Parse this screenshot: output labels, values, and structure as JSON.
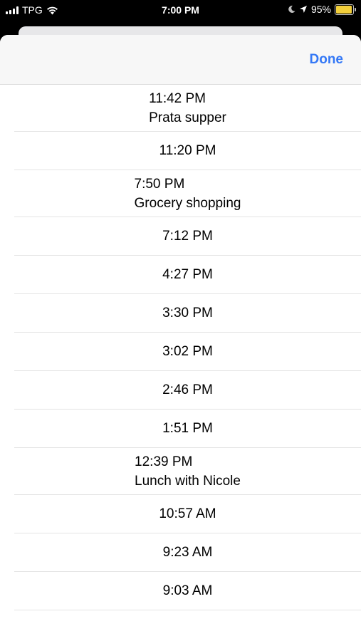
{
  "status_bar": {
    "carrier": "TPG",
    "time": "7:00 PM",
    "battery_percent": "95%",
    "battery_level": 0.95,
    "icons": [
      "signal-icon",
      "wifi-icon",
      "moon-icon",
      "location-arrow-icon",
      "battery-icon"
    ],
    "battery_color": "#f2cf3b"
  },
  "header": {
    "done_label": "Done",
    "accent_color": "#3478f6"
  },
  "times": [
    {
      "time": "11:42 PM",
      "title": "Prata supper"
    },
    {
      "time": "11:20 PM",
      "title": ""
    },
    {
      "time": "7:50 PM",
      "title": "Grocery shopping"
    },
    {
      "time": "7:12 PM",
      "title": ""
    },
    {
      "time": "4:27 PM",
      "title": ""
    },
    {
      "time": "3:30 PM",
      "title": ""
    },
    {
      "time": "3:02 PM",
      "title": ""
    },
    {
      "time": "2:46 PM",
      "title": ""
    },
    {
      "time": "1:51 PM",
      "title": ""
    },
    {
      "time": "12:39 PM",
      "title": "Lunch with Nicole"
    },
    {
      "time": "10:57 AM",
      "title": ""
    },
    {
      "time": "9:23 AM",
      "title": ""
    },
    {
      "time": "9:03 AM",
      "title": ""
    }
  ]
}
